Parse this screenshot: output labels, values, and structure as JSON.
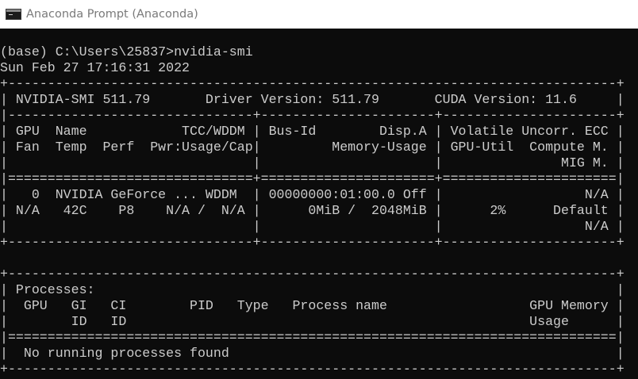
{
  "window": {
    "title": "Anaconda Prompt (Anaconda)",
    "icon": "terminal-icon"
  },
  "console": {
    "lines": [
      "(base) C:\\Users\\25837>nvidia-smi",
      "Sun Feb 27 17:16:31 2022",
      "+-----------------------------------------------------------------------------+",
      "| NVIDIA-SMI 511.79       Driver Version: 511.79       CUDA Version: 11.6     |",
      "|-------------------------------+----------------------+----------------------+",
      "| GPU  Name            TCC/WDDM | Bus-Id        Disp.A | Volatile Uncorr. ECC |",
      "| Fan  Temp  Perf  Pwr:Usage/Cap|         Memory-Usage | GPU-Util  Compute M. |",
      "|                               |                      |               MIG M. |",
      "|===============================+======================+======================|",
      "|   0  NVIDIA GeForce ... WDDM  | 00000000:01:00.0 Off |                  N/A |",
      "| N/A   42C    P8    N/A /  N/A |      0MiB /  2048MiB |      2%      Default |",
      "|                               |                      |                  N/A |",
      "+-------------------------------+----------------------+----------------------+",
      "",
      "+-----------------------------------------------------------------------------+",
      "| Processes:                                                                  |",
      "|  GPU   GI   CI        PID   Type   Process name                  GPU Memory |",
      "|        ID   ID                                                   Usage      |",
      "|=============================================================================|",
      "|  No running processes found                                                 |",
      "+-----------------------------------------------------------------------------+"
    ]
  }
}
